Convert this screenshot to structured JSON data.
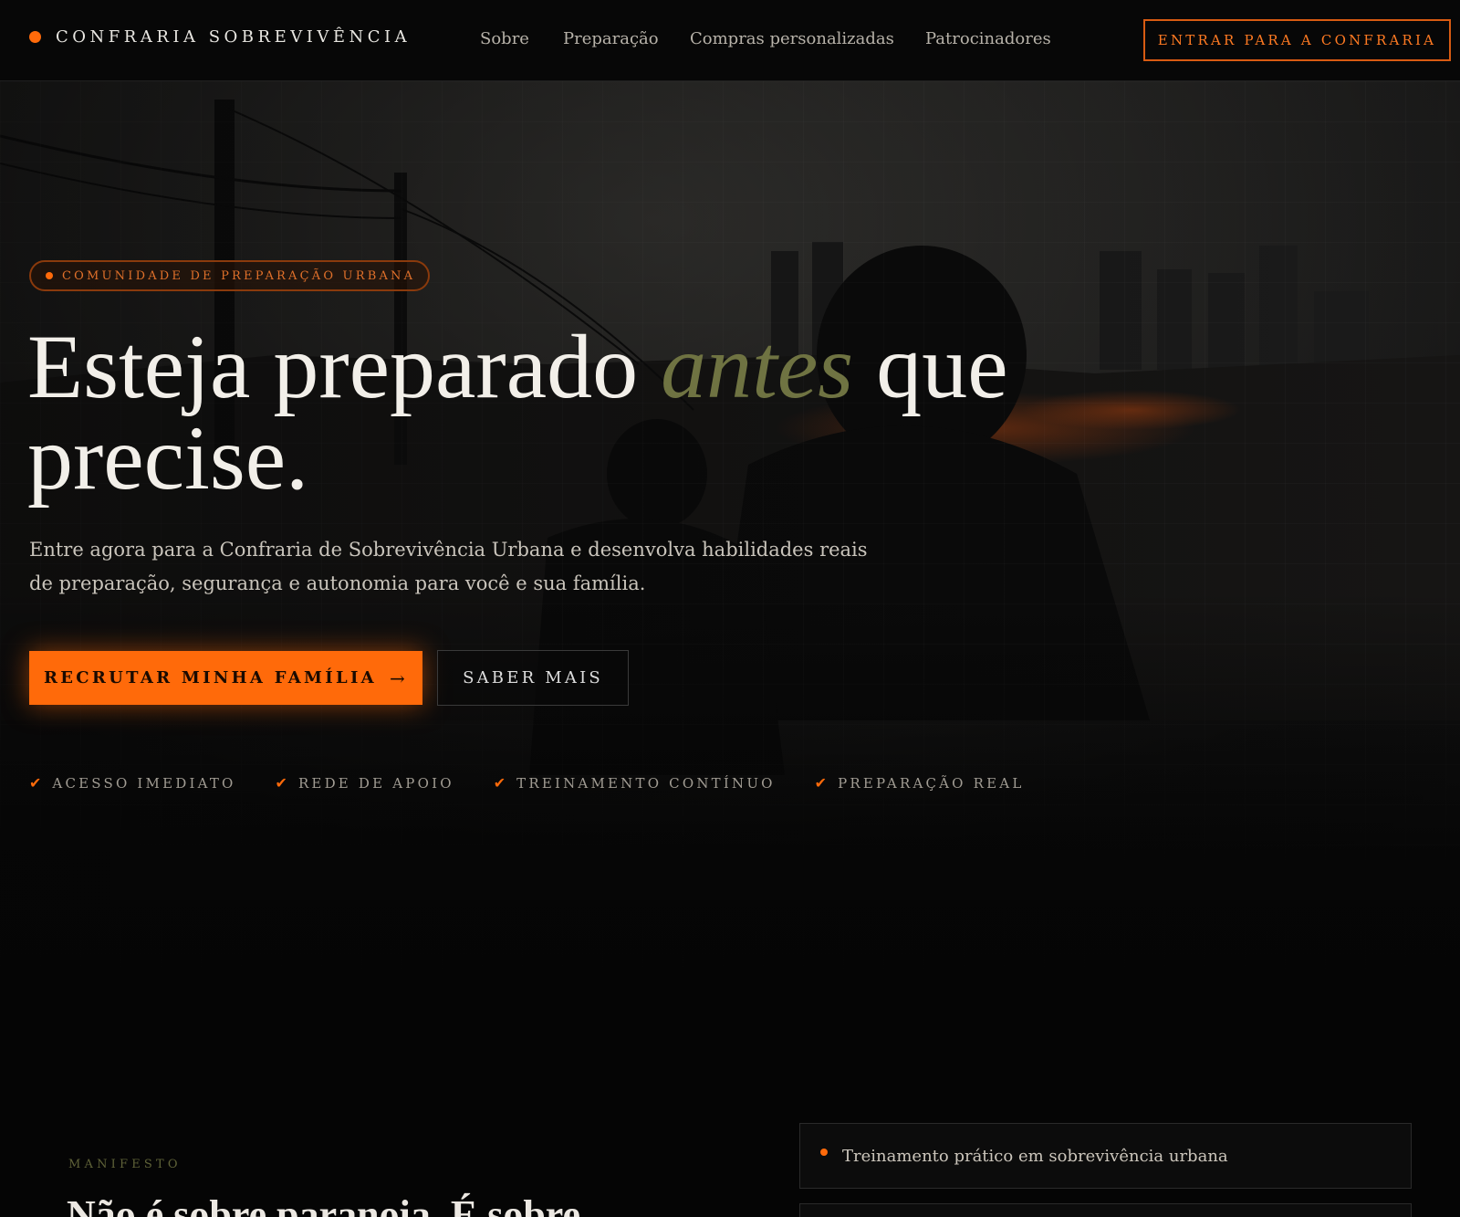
{
  "header": {
    "brand": "CONFRARIA SOBREVIVÊNCIA",
    "nav": [
      "Sobre",
      "Preparação",
      "Compras personalizadas",
      "Patrocinadores"
    ],
    "cta": "ENTRAR PARA A CONFRARIA"
  },
  "hero": {
    "badge": "COMUNIDADE DE PREPARAÇÃO URBANA",
    "headline_part1": "Esteja preparado ",
    "headline_accent": "antes",
    "headline_part2": " que precise.",
    "lead": "Entre agora para a Confraria de Sobrevivência Urbana e desenvolva habilidades reais de preparação, segurança e autonomia para você e sua família.",
    "primary_button": "RECRUTAR MINHA FAMÍLIA",
    "primary_arrow": "→",
    "secondary_button": "SABER MAIS",
    "features": [
      "ACESSO IMEDIATO",
      "REDE DE APOIO",
      "TREINAMENTO CONTÍNUO",
      "PREPARAÇÃO REAL"
    ],
    "check_glyph": "✔"
  },
  "manifesto": {
    "eyebrow": "MANIFESTO",
    "heading": "Não é sobre paranoia. É sobre",
    "items": [
      "Treinamento prático em sobrevivência urbana",
      ""
    ]
  },
  "colors": {
    "accent": "#ff6a0a",
    "olive": "#6f7342",
    "background": "#050505"
  }
}
